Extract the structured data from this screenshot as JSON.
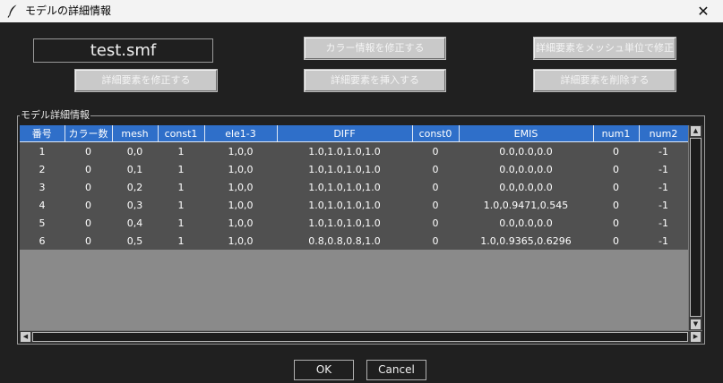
{
  "window": {
    "title": "モデルの詳細情報",
    "close_glyph": "✕",
    "app_icon": "quill-feather-icon"
  },
  "file_name": "test.smf",
  "toolbar": {
    "color_edit": "カラー情報を修正する",
    "mesh_edit": "詳細要素をメッシュ単位で修正",
    "detail_edit": "詳細要素を修正する",
    "detail_insert": "詳細要素を挿入する",
    "detail_delete": "詳細要素を削除する"
  },
  "group": {
    "label": "モデル詳細情報"
  },
  "table": {
    "columns": [
      "番号",
      "カラー数",
      "mesh",
      "const1",
      "ele1-3",
      "DIFF",
      "const0",
      "EMIS",
      "num1",
      "num2"
    ],
    "rows": [
      [
        "1",
        "0",
        "0,0",
        "1",
        "1,0,0",
        "1.0,1.0,1.0,1.0",
        "0",
        "0.0,0.0,0.0",
        "0",
        "-1"
      ],
      [
        "2",
        "0",
        "0,1",
        "1",
        "1,0,0",
        "1.0,1.0,1.0,1.0",
        "0",
        "0.0,0.0,0.0",
        "0",
        "-1"
      ],
      [
        "3",
        "0",
        "0,2",
        "1",
        "1,0,0",
        "1.0,1.0,1.0,1.0",
        "0",
        "0.0,0.0,0.0",
        "0",
        "-1"
      ],
      [
        "4",
        "0",
        "0,3",
        "1",
        "1,0,0",
        "1.0,1.0,1.0,1.0",
        "0",
        "1.0,0.9471,0.545",
        "0",
        "-1"
      ],
      [
        "5",
        "0",
        "0,4",
        "1",
        "1,0,0",
        "1.0,1.0,1.0,1.0",
        "0",
        "0.0,0.0,0.0",
        "0",
        "-1"
      ],
      [
        "6",
        "0",
        "0,5",
        "1",
        "1,0,0",
        "0.8,0.8,0.8,1.0",
        "0",
        "1.0,0.9365,0.6296",
        "0",
        "-1"
      ]
    ]
  },
  "dialog": {
    "ok": "OK",
    "cancel": "Cancel"
  },
  "colors": {
    "background": "#202020",
    "header_bg": "#2f6fc9",
    "row_bg": "#505050",
    "empty_area": "#8a8a8a",
    "disabled_button": "#c9c9c9"
  }
}
